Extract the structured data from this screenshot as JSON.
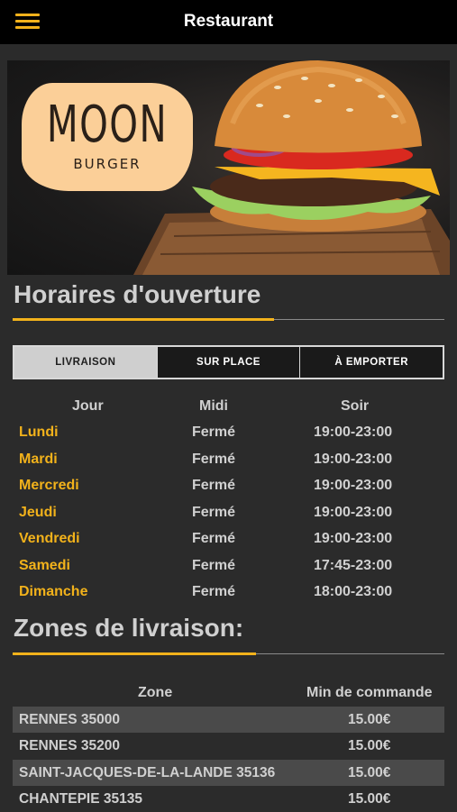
{
  "header": {
    "title": "Restaurant"
  },
  "hero": {
    "logo_main": "MOON",
    "logo_sub": "BURGER"
  },
  "hours_section": {
    "title": "Horaires d'ouverture",
    "tabs": [
      {
        "label": "LIVRAISON"
      },
      {
        "label": "SUR PLACE"
      },
      {
        "label": "À EMPORTER"
      }
    ],
    "columns": {
      "day": "Jour",
      "midi": "Midi",
      "soir": "Soir"
    },
    "rows": [
      {
        "day": "Lundi",
        "midi": "Fermé",
        "soir": "19:00-23:00"
      },
      {
        "day": "Mardi",
        "midi": "Fermé",
        "soir": "19:00-23:00"
      },
      {
        "day": "Mercredi",
        "midi": "Fermé",
        "soir": "19:00-23:00"
      },
      {
        "day": "Jeudi",
        "midi": "Fermé",
        "soir": "19:00-23:00"
      },
      {
        "day": "Vendredi",
        "midi": "Fermé",
        "soir": "19:00-23:00"
      },
      {
        "day": "Samedi",
        "midi": "Fermé",
        "soir": "17:45-23:00"
      },
      {
        "day": "Dimanche",
        "midi": "Fermé",
        "soir": "18:00-23:00"
      }
    ]
  },
  "zones_section": {
    "title": "Zones de livraison:",
    "columns": {
      "zone": "Zone",
      "min": "Min de commande"
    },
    "rows": [
      {
        "zone": "RENNES 35000",
        "min": "15.00€"
      },
      {
        "zone": "RENNES 35200",
        "min": "15.00€"
      },
      {
        "zone": "SAINT-JACQUES-DE-LA-LANDE 35136",
        "min": "15.00€"
      },
      {
        "zone": "CHANTEPIE 35135",
        "min": "15.00€"
      }
    ]
  },
  "colors": {
    "accent": "#f2b21b",
    "background": "#2b2b2b",
    "topbar": "#000000"
  },
  "icons": {
    "menu": "hamburger-menu-icon"
  }
}
